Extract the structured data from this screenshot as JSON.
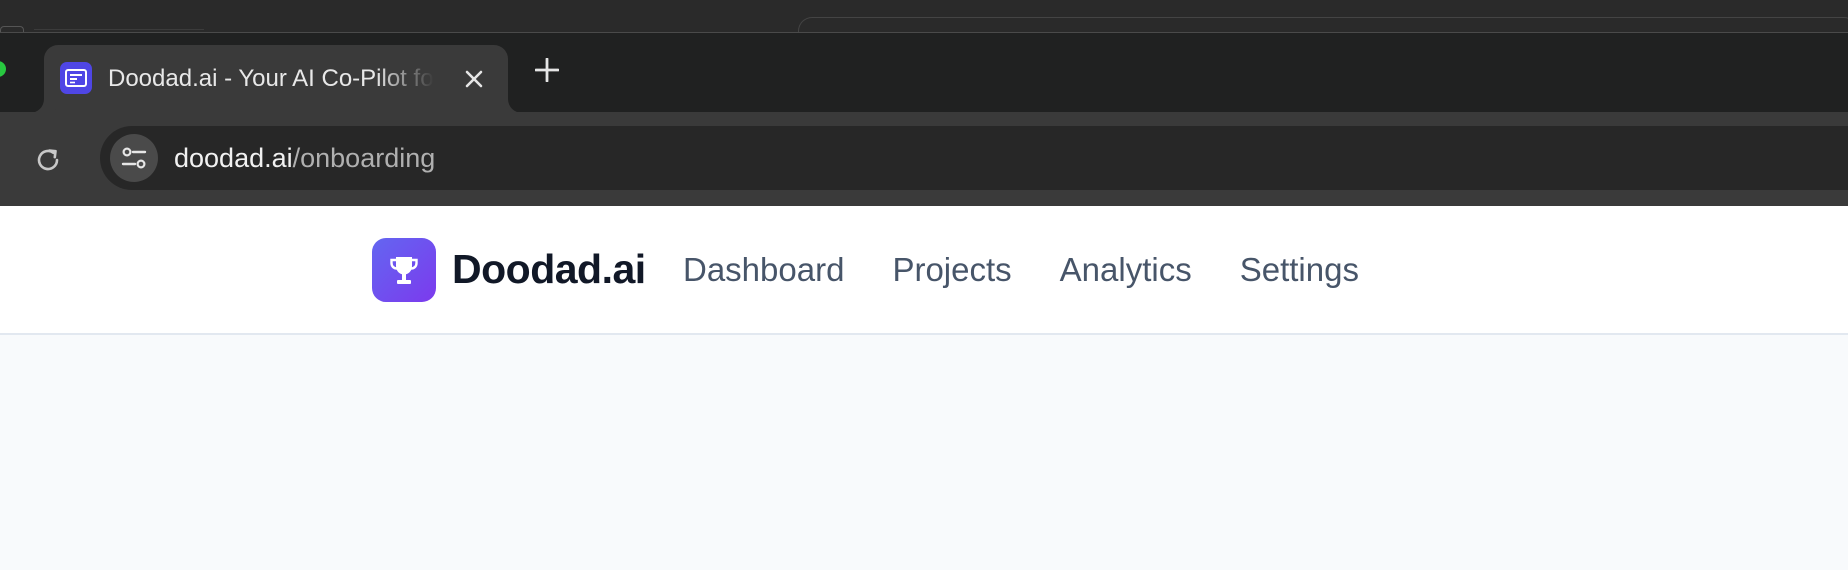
{
  "browser": {
    "tab": {
      "title": "Doodad.ai - Your AI Co-Pilot for Projects",
      "favicon": "card-icon"
    },
    "address_bar": {
      "host": "doodad.ai",
      "path": "/onboarding"
    },
    "icons": {
      "new_tab": "plus-icon",
      "close_tab": "close-icon",
      "reload": "reload-icon",
      "site_info": "tune-icon"
    }
  },
  "app": {
    "brand": "Doodad.ai",
    "logo_icon": "trophy-icon",
    "nav": [
      {
        "label": "Dashboard"
      },
      {
        "label": "Projects"
      },
      {
        "label": "Analytics"
      },
      {
        "label": "Settings"
      }
    ]
  },
  "colors": {
    "brand_gradient_start": "#6366f1",
    "brand_gradient_end": "#7c3aed",
    "nav_text": "#475569",
    "page_bg": "#f8fafc"
  }
}
